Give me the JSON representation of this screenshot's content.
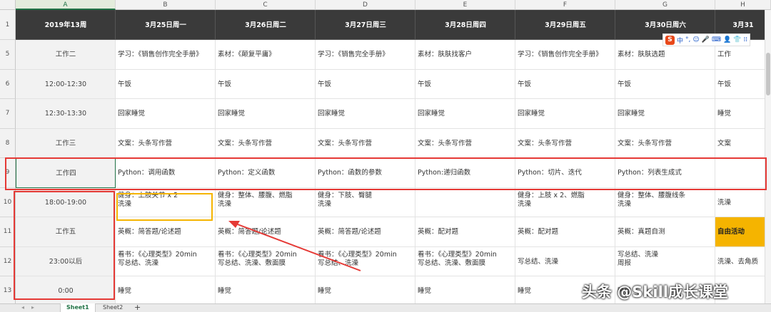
{
  "columns": [
    "A",
    "B",
    "C",
    "D",
    "E",
    "F",
    "G",
    "H"
  ],
  "header_row": {
    "row_number": "1",
    "cells": [
      "2019年13周",
      "3月25日周一",
      "3月26日周二",
      "3月27日周三",
      "3月28日周四",
      "3月29日周五",
      "3月30日周六",
      "3月31"
    ]
  },
  "rows": [
    {
      "row_number": "5",
      "cells": [
        "工作二",
        "学习：《销售创作完全手册》",
        "素材：《颠复平庸》",
        "学习：《销售完全手册》",
        "素材：肤肤找客户",
        "学习：《销售创作完全手册》",
        "素材：肤肤选题",
        "工作"
      ]
    },
    {
      "row_number": "6",
      "cells": [
        "12:00-12:30",
        "午饭",
        "午饭",
        "午饭",
        "午饭",
        "午饭",
        "午饭",
        "午饭"
      ]
    },
    {
      "row_number": "7",
      "cells": [
        "12:30-13:30",
        "回家睡觉",
        "回家睡觉",
        "回家睡觉",
        "回家睡觉",
        "回家睡觉",
        "回家睡觉",
        "睡觉"
      ]
    },
    {
      "row_number": "8",
      "cells": [
        "工作三",
        "文案：头条写作营",
        "文案：头条写作营",
        "文案：头条写作营",
        "文案：头条写作营",
        "文案：头条写作营",
        "文案：头条写作营",
        "文案"
      ]
    },
    {
      "row_number": "9",
      "cells": [
        "工作四",
        "Python：调用函数",
        "Python：定义函数",
        "Python：函数的参数",
        "Python:递归函数",
        "Python：切片、迭代",
        "Python：列表生成式",
        ""
      ]
    },
    {
      "row_number": "10",
      "cells": [
        "18:00-19:00",
        "健身：上肢关节 x 2\n洗澡",
        "健身：整体、腰腹、燃脂\n洗澡",
        "健身：下肢、臀腿\n洗澡",
        "",
        "健身：上肢 x 2、燃脂\n洗澡",
        "健身：整体、腰腹线条\n洗澡",
        "洗澡"
      ]
    },
    {
      "row_number": "11",
      "cells": [
        "工作五",
        "英概：简答题/论述题",
        "英概：简答题/论述题",
        "英概：简答题/论述题",
        "英概：配对题",
        "英概：配对题",
        "英概：真题自测",
        "自由活动"
      ]
    },
    {
      "row_number": "12",
      "cells": [
        "23:00以后",
        "看书：《心理类型》20min\n写总结、洗澡",
        "看书：《心理类型》20min\n写总结、洗澡、敷面膜",
        "看书：《心理类型》20min\n写总结、洗澡",
        "看书：《心理类型》20min\n写总结、洗澡、敷面膜",
        "写总结、洗澡",
        "写总结、洗澡\n周报",
        "洗澡、去角质"
      ]
    },
    {
      "row_number": "13",
      "cells": [
        "0:00",
        "睡觉",
        "睡觉",
        "睡觉",
        "睡觉",
        "睡觉",
        "睡觉",
        ""
      ]
    }
  ],
  "sheet_tabs": [
    "Sheet1",
    "Sheet2"
  ],
  "add_sheet_label": "+",
  "nav_arrows": [
    "◂",
    "▸"
  ],
  "ime_toolbar": {
    "logo": "S",
    "items": [
      "中",
      "°,",
      "☺",
      "🎤",
      "⌨",
      "👤",
      "👕",
      "⁞⁞"
    ]
  },
  "watermark": "头条 @Skill成长课堂",
  "colors": {
    "header_bg": "#3a3a3a",
    "highlight_red": "#e53935",
    "highlight_yellow": "#f5b400",
    "arrow_red": "#e53935",
    "selected_green": "#217346",
    "free_activity_bg": "#f5b400"
  }
}
